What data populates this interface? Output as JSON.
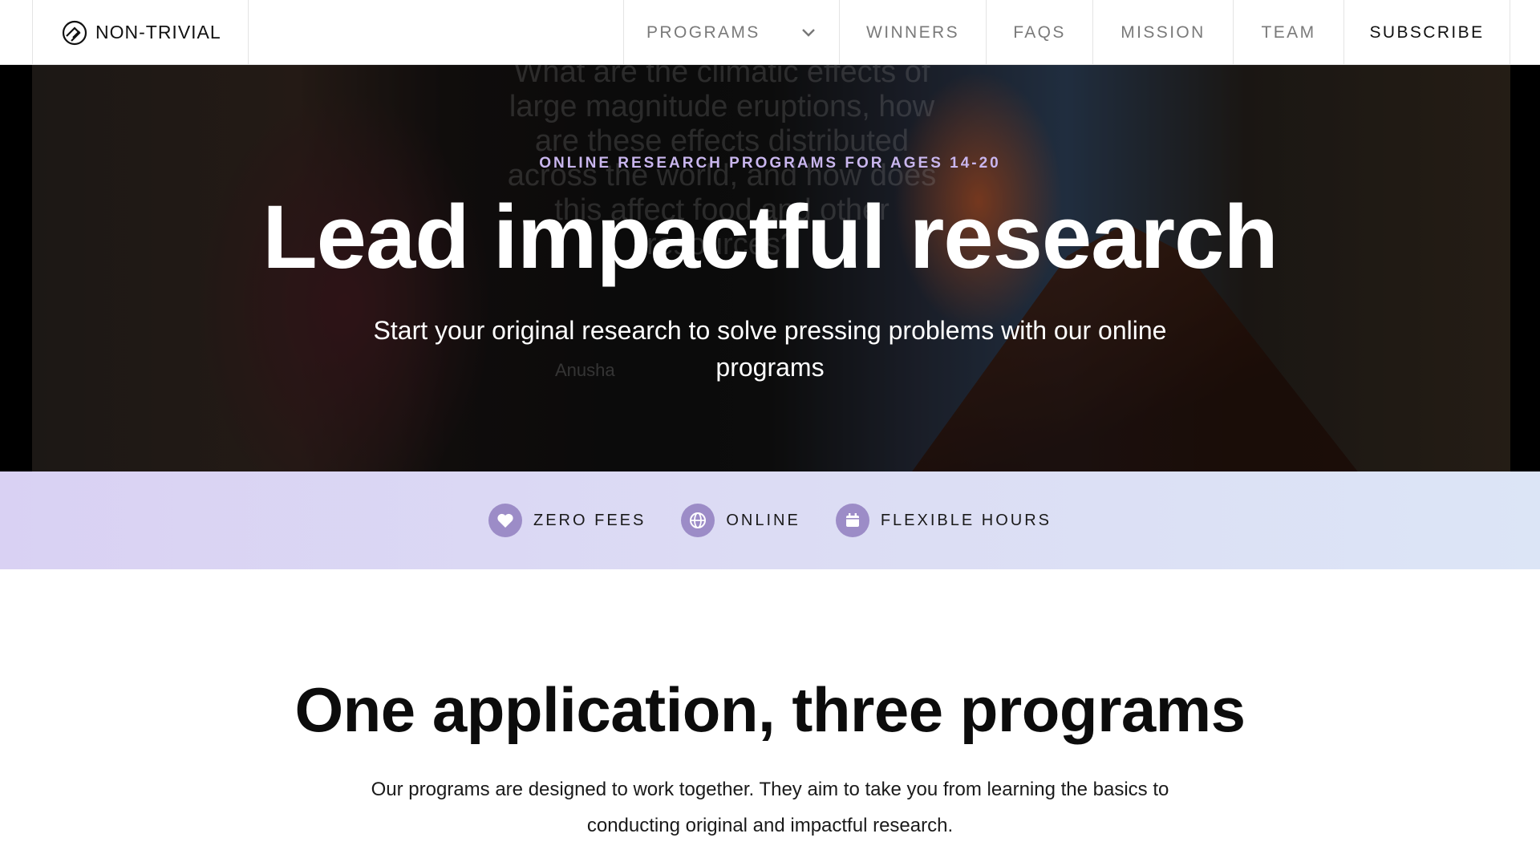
{
  "nav": {
    "brand": "NON-TRIVIAL",
    "items": [
      {
        "label": "PROGRAMS"
      },
      {
        "label": "WINNERS"
      },
      {
        "label": "FAQS"
      },
      {
        "label": "MISSION"
      },
      {
        "label": "TEAM"
      },
      {
        "label": "SUBSCRIBE"
      }
    ]
  },
  "hero": {
    "background_text": "What are the climatic effects of large magnitude eruptions, how are these effects distributed across the world, and how does this affect food and other resources?",
    "speaker_name": "Anusha",
    "eyebrow": "ONLINE RESEARCH PROGRAMS FOR AGES 14-20",
    "title": "Lead impactful research",
    "subtitle": "Start your original research to solve pressing problems with our online programs"
  },
  "features": [
    {
      "icon": "heart-icon",
      "label": "ZERO FEES"
    },
    {
      "icon": "globe-icon",
      "label": "ONLINE"
    },
    {
      "icon": "calendar-icon",
      "label": "FLEXIBLE HOURS"
    }
  ],
  "programs_section": {
    "title": "One application, three programs",
    "text": "Our programs are designed to work together. They aim to take you from learning the basics to conducting original and impactful research."
  },
  "colors": {
    "accent": "#9c8cc7",
    "eyebrow": "#c9b6ee",
    "strip_start": "#d9d1f3",
    "strip_end": "#dce5f6"
  }
}
